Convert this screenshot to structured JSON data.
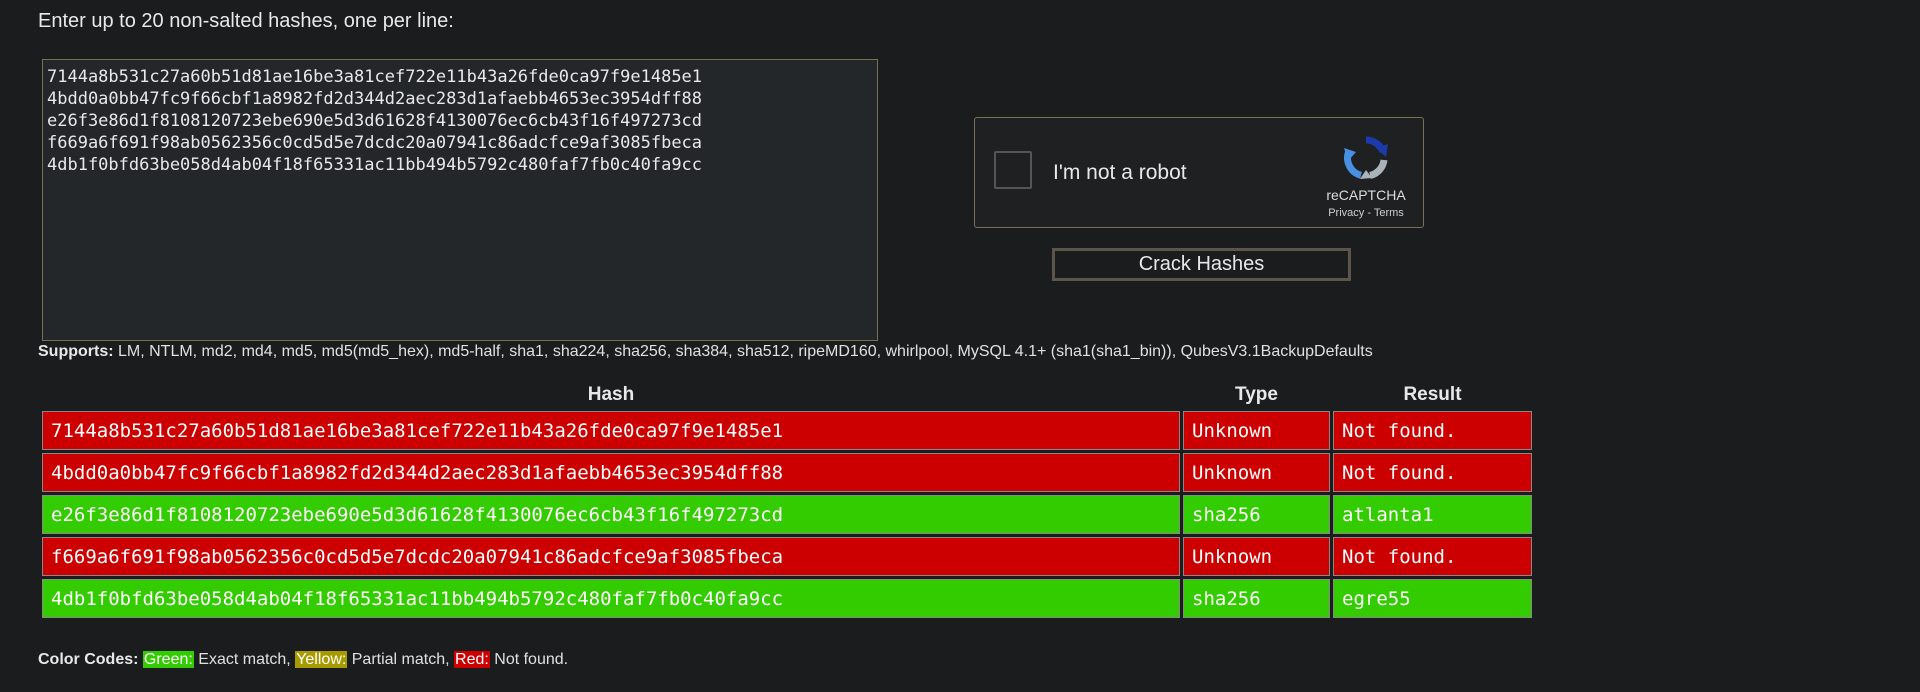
{
  "intro": "Enter up to 20 non-salted hashes, one per line:",
  "input": {
    "value": "7144a8b531c27a60b51d81ae16be3a81cef722e11b43a26fde0ca97f9e1485e1\n4bdd0a0bb47fc9f66cbf1a8982fd2d344d2aec283d1afaebb4653ec3954dff88\ne26f3e86d1f8108120723ebe690e5d3d61628f4130076ec6cb43f16f497273cd\nf669a6f691f98ab0562356c0cd5d5e7dcdc20a07941c86adcfce9af3085fbeca\n4db1f0bfd63be058d4ab04f18f65331ac11bb494b5792c480faf7fb0c40fa9cc"
  },
  "recaptcha": {
    "label": "I'm not a robot",
    "brand": "reCAPTCHA",
    "privacy": "Privacy",
    "separator": " - ",
    "terms": "Terms",
    "icon": "recaptcha-logo-icon"
  },
  "crack_button": "Crack Hashes",
  "supports": {
    "label": "Supports:",
    "text": " LM, NTLM, md2, md4, md5, md5(md5_hex), md5-half, sha1, sha224, sha256, sha384, sha512, ripeMD160, whirlpool, MySQL 4.1+ (sha1(sha1_bin)), QubesV3.1BackupDefaults"
  },
  "results": {
    "headers": {
      "hash": "Hash",
      "type": "Type",
      "result": "Result"
    },
    "rows": [
      {
        "hash": "7144a8b531c27a60b51d81ae16be3a81cef722e11b43a26fde0ca97f9e1485e1",
        "type": "Unknown",
        "result": "Not found.",
        "status": "red"
      },
      {
        "hash": "4bdd0a0bb47fc9f66cbf1a8982fd2d344d2aec283d1afaebb4653ec3954dff88",
        "type": "Unknown",
        "result": "Not found.",
        "status": "red"
      },
      {
        "hash": "e26f3e86d1f8108120723ebe690e5d3d61628f4130076ec6cb43f16f497273cd",
        "type": "sha256",
        "result": "atlanta1",
        "status": "green"
      },
      {
        "hash": "f669a6f691f98ab0562356c0cd5d5e7dcdc20a07941c86adcfce9af3085fbeca",
        "type": "Unknown",
        "result": "Not found.",
        "status": "red"
      },
      {
        "hash": "4db1f0bfd63be058d4ab04f18f65331ac11bb494b5792c480faf7fb0c40fa9cc",
        "type": "sha256",
        "result": "egre55",
        "status": "green"
      }
    ]
  },
  "legend": {
    "label": "Color Codes:",
    "green": "Green:",
    "green_text": " Exact match, ",
    "yellow": "Yellow:",
    "yellow_text": " Partial match, ",
    "red": "Red:",
    "red_text": " Not found."
  },
  "colors": {
    "background": "#1b1c1e",
    "not_found": "#cc0000",
    "exact_match": "#33cc00",
    "partial_match": "#a89b00",
    "border": "#7a7058"
  }
}
